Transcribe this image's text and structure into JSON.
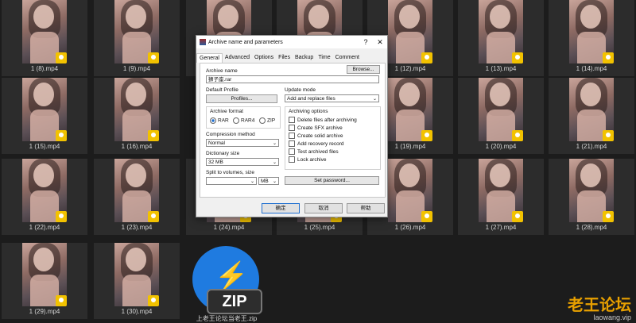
{
  "grid": {
    "tiles": [
      {
        "caption": "1 (8).mp4"
      },
      {
        "caption": "1 (9).mp4"
      },
      {
        "caption": ""
      },
      {
        "caption": ""
      },
      {
        "caption": "1 (12).mp4"
      },
      {
        "caption": "1 (13).mp4"
      },
      {
        "caption": "1 (14).mp4"
      },
      {
        "caption": "1 (15).mp4"
      },
      {
        "caption": "1 (16).mp4"
      },
      {
        "caption": "1 (19).mp4"
      },
      {
        "caption": "1 (20).mp4"
      },
      {
        "caption": "1 (21).mp4"
      },
      {
        "caption": "1 (22).mp4"
      },
      {
        "caption": "1 (23).mp4"
      },
      {
        "caption": "1 (24).mp4"
      },
      {
        "caption": "1 (25).mp4"
      },
      {
        "caption": "1 (26).mp4"
      },
      {
        "caption": "1 (27).mp4"
      },
      {
        "caption": "1 (28).mp4"
      },
      {
        "caption": "1 (29).mp4"
      },
      {
        "caption": "1 (30).mp4"
      }
    ],
    "zip": {
      "icon_text": "ZIP",
      "caption": "上老王论坛当老王.zip"
    }
  },
  "watermark": {
    "main": "老王论坛",
    "sub": "laowang.vip"
  },
  "dialog": {
    "title": "Archive name and parameters",
    "help_glyph": "?",
    "close_glyph": "✕",
    "tabs": [
      "General",
      "Advanced",
      "Options",
      "Files",
      "Backup",
      "Time",
      "Comment"
    ],
    "archive_name_label": "Archive name",
    "browse_label": "Browse...",
    "archive_name_value": "狮子座.rar",
    "default_profile_label": "Default Profile",
    "profiles_label": "Profiles...",
    "update_mode_label": "Update mode",
    "update_mode_value": "Add and replace files",
    "archive_format_label": "Archive format",
    "formats": [
      "RAR",
      "RAR4",
      "ZIP"
    ],
    "compression_label": "Compression method",
    "compression_value": "Normal",
    "dictionary_label": "Dictionary size",
    "dictionary_value": "32 MB",
    "split_label": "Split to volumes, size",
    "split_unit": "MB",
    "archiving_options_label": "Archiving options",
    "options": [
      "Delete files after archiving",
      "Create SFX archive",
      "Create solid archive",
      "Add recovery record",
      "Test archived files",
      "Lock archive"
    ],
    "set_password_label": "Set password...",
    "ok_label": "确定",
    "cancel_label": "取消",
    "help_label": "帮助"
  }
}
